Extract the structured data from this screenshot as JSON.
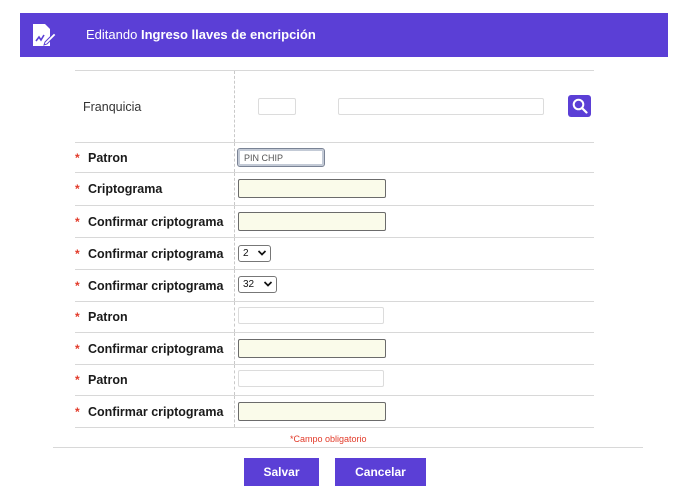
{
  "header": {
    "prefix": "Editando",
    "title": "Ingreso llaves de encripción",
    "icon": "edit-document-icon",
    "color": "#5b3fd6"
  },
  "form": {
    "franquicia": {
      "label": "Franquicia",
      "code_value": "",
      "name_value": "",
      "search_icon": "search-icon"
    },
    "rows": [
      {
        "label": "Patron",
        "required": true,
        "value": "PIN CHIP"
      },
      {
        "label": "Criptograma",
        "required": true,
        "value": ""
      },
      {
        "label": "Confirmar criptograma",
        "required": true,
        "value": ""
      },
      {
        "label": "Confirmar criptograma",
        "required": true,
        "value": "2"
      },
      {
        "label": "Confirmar criptograma",
        "required": true,
        "value": "32"
      },
      {
        "label": "Patron",
        "required": true,
        "value": ""
      },
      {
        "label": "Confirmar criptograma",
        "required": true,
        "value": ""
      },
      {
        "label": "Patron",
        "required": true,
        "value": ""
      },
      {
        "label": "Confirmar criptograma",
        "required": true,
        "value": ""
      }
    ],
    "required_marker": "*",
    "required_note": "*Campo obligatorio"
  },
  "actions": {
    "save": "Salvar",
    "cancel": "Cancelar"
  }
}
